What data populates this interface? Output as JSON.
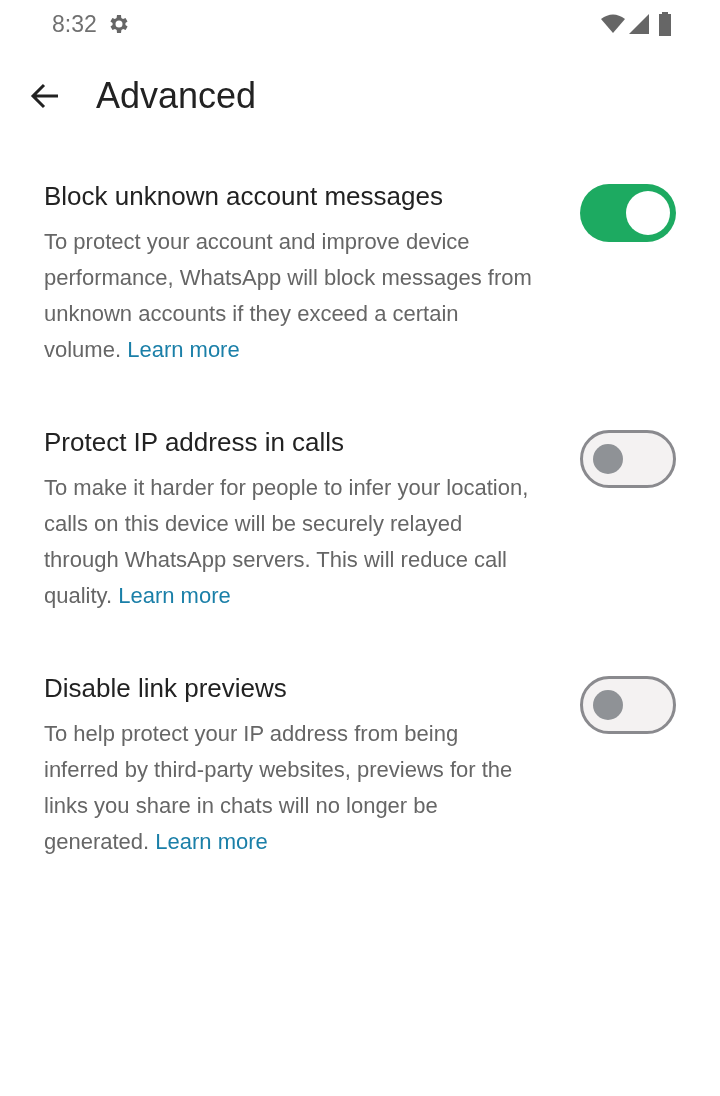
{
  "status_bar": {
    "time": "8:32"
  },
  "header": {
    "title": "Advanced"
  },
  "settings": [
    {
      "title": "Block unknown account messages",
      "description": "To protect your account and improve device performance, WhatsApp will block messages from unknown accounts if they exceed a certain volume.",
      "link": "Learn more",
      "on": true
    },
    {
      "title": "Protect IP address in calls",
      "description": "To make it harder for people to infer your location, calls on this device will be securely relayed through WhatsApp servers. This will reduce call quality.",
      "link": "Learn more",
      "on": false
    },
    {
      "title": "Disable link previews",
      "description": "To help protect your IP address from being inferred by third-party websites, previews for the links you share in chats will no longer be generated.",
      "link": "Learn more",
      "on": false
    }
  ]
}
